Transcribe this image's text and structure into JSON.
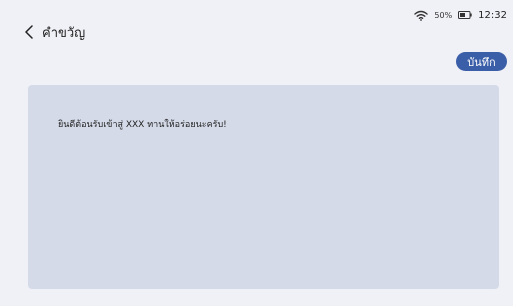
{
  "status_bar": {
    "battery_percent": "50%",
    "time": "12:32",
    "icons": [
      "wifi-icon",
      "battery-icon"
    ]
  },
  "header": {
    "back_icon": "chevron-left-icon",
    "title": "คำขวัญ"
  },
  "toolbar": {
    "save_label": "บันทึก"
  },
  "welcome_message": {
    "text": "ยินดีต้อนรับเข้าสู่ XXX ทานให้อร่อยนะครับ!"
  },
  "colors": {
    "accent": "#3b5ea8",
    "background": "#f0f1f6",
    "message_area": "#d4dae8"
  }
}
